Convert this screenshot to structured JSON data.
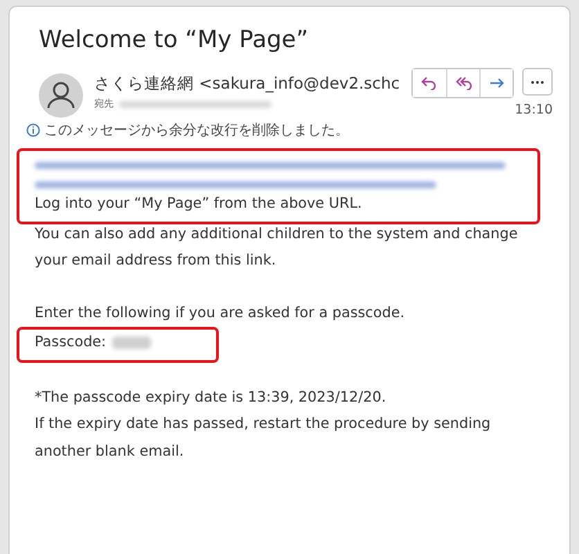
{
  "message": {
    "subject": "Welcome to “My Page”",
    "sender": "さくら連絡網 <sakura_info@dev2.schc",
    "to_label": "宛先",
    "time": "13:10",
    "actions": [
      {
        "kind": "reply"
      },
      {
        "kind": "reply-all"
      },
      {
        "kind": "forward"
      }
    ],
    "notice": "このメッセージから余分な改行を削除しました。"
  },
  "body": [
    {
      "highlighted": true,
      "redacted_link": true,
      "gap_before": false,
      "lines": [
        "Log into your “My Page” from the above URL."
      ]
    },
    {
      "highlighted": false,
      "gap_before": false,
      "lines": [
        "You can also add any additional children to the system and change your email address from this link."
      ]
    },
    {
      "highlighted": false,
      "gap_before": true,
      "lines": [
        "Enter the following if you are asked for a passcode."
      ]
    },
    {
      "highlighted": true,
      "redacted_value": true,
      "gap_before": false,
      "lines": [
        "Passcode:"
      ]
    },
    {
      "highlighted": false,
      "gap_before": true,
      "lines": [
        "*The passcode expiry date is 13:39, 2023/12/20.",
        "If the expiry date has passed, restart the procedure by sending another blank email."
      ]
    }
  ]
}
